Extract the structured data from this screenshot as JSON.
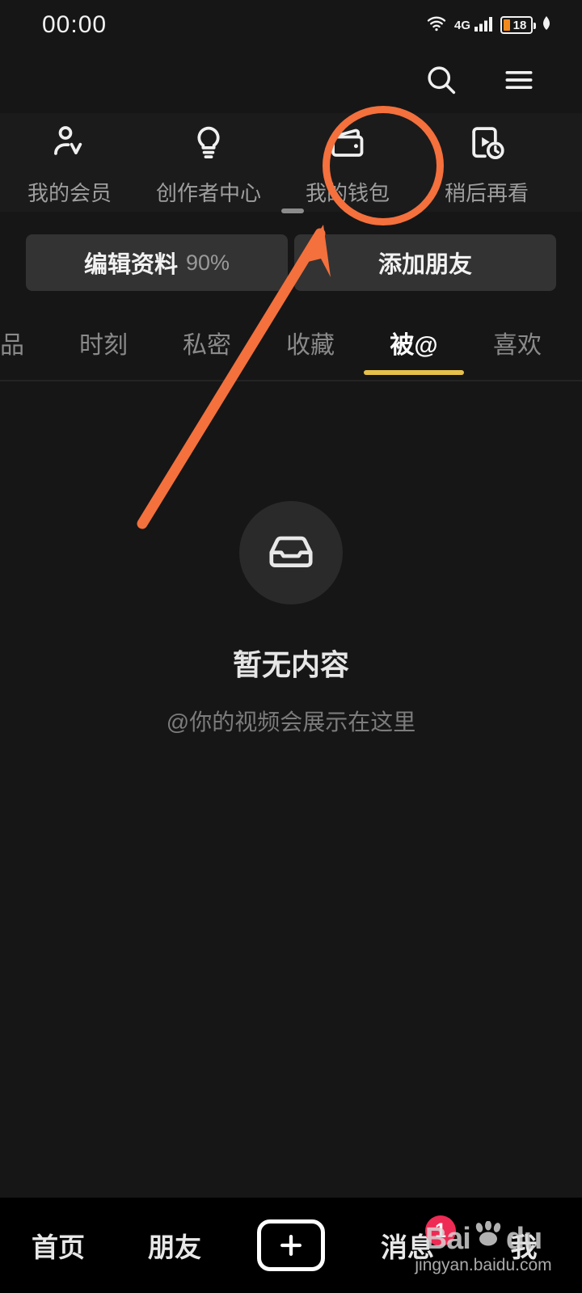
{
  "status_bar": {
    "time": "00:00",
    "network_type": "4G",
    "battery_level": "18",
    "icons": [
      "wifi-icon",
      "signal-icon",
      "battery-icon",
      "leaf-icon"
    ]
  },
  "header": {
    "search_icon": "search-icon",
    "menu_icon": "hamburger-menu-icon"
  },
  "quick_actions": [
    {
      "label": "我的会员",
      "icon": "member-person-icon"
    },
    {
      "label": "创作者中心",
      "icon": "lightbulb-icon"
    },
    {
      "label": "我的钱包",
      "icon": "wallet-icon"
    },
    {
      "label": "稍后再看",
      "icon": "watch-later-icon"
    }
  ],
  "profile_buttons": {
    "edit_profile_label": "编辑资料",
    "edit_profile_percent": "90%",
    "add_friend_label": "添加朋友"
  },
  "tabs": {
    "items": [
      {
        "label": "品",
        "active": false
      },
      {
        "label": "时刻",
        "active": false
      },
      {
        "label": "私密",
        "active": false
      },
      {
        "label": "收藏",
        "active": false
      },
      {
        "label": "被@",
        "active": true
      },
      {
        "label": "喜欢",
        "active": false
      }
    ],
    "active_underline_color": "#e5c14a"
  },
  "empty_state": {
    "icon": "inbox-tray-icon",
    "title": "暂无内容",
    "subtitle": "@你的视频会展示在这里"
  },
  "annotations": {
    "highlight_color": "#f4703c",
    "circle_target": "我的钱包",
    "arrow": "points-to-wallet"
  },
  "bottom_nav": {
    "items": [
      {
        "label": "首页",
        "badge": ""
      },
      {
        "label": "朋友",
        "badge": ""
      },
      {
        "label": "",
        "icon": "create-plus-icon",
        "badge": ""
      },
      {
        "label": "消息",
        "badge": "1"
      },
      {
        "label": "我",
        "badge": ""
      }
    ],
    "badge_color": "#ee2b55"
  },
  "watermark": {
    "brand_bai": "Bai",
    "brand_du": "du",
    "url": "jingyan.baidu.com"
  }
}
